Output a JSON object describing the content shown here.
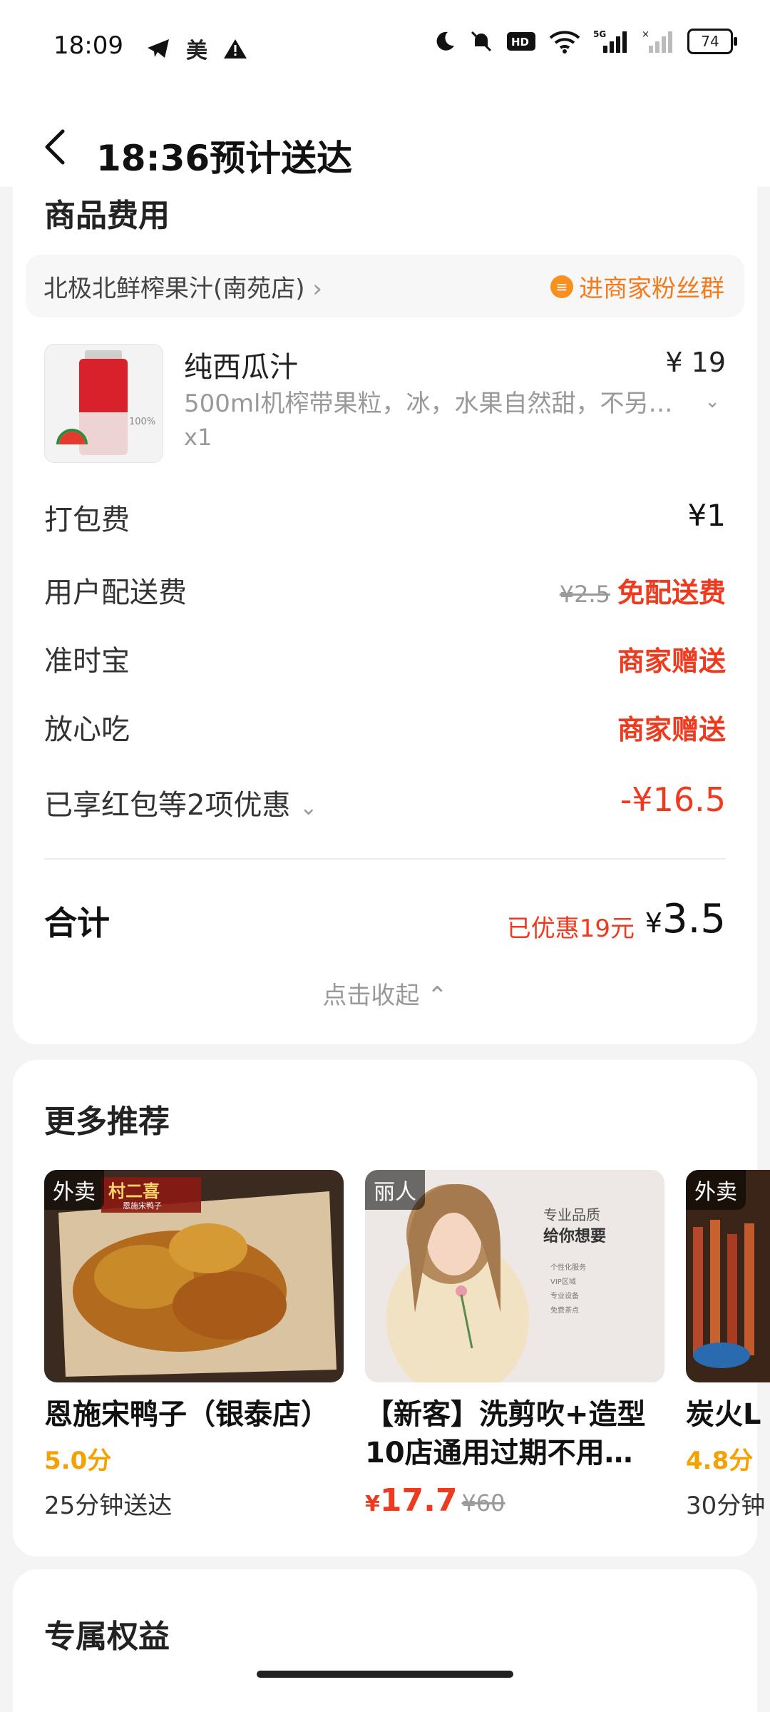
{
  "status_bar": {
    "time": "18:09",
    "carrier_tag": "美",
    "network": "5G",
    "battery": "74"
  },
  "header": {
    "title": "18:36预计送达"
  },
  "fees": {
    "section_title": "商品费用",
    "shop_name": "北极北鲜榨果汁(南苑店)",
    "fan_group": "进商家粉丝群",
    "product": {
      "name": "纯西瓜汁",
      "desc": "500ml机榨带果粒，冰，水果自然甜，不另…",
      "qty": "x1",
      "price": "¥ 19",
      "image_label": "100%"
    },
    "rows": [
      {
        "label": "打包费",
        "value": "¥1"
      },
      {
        "label": "用户配送费",
        "original": "¥2.5",
        "value": "免配送费"
      },
      {
        "label": "准时宝",
        "value": "商家赠送"
      },
      {
        "label": "放心吃",
        "value": "商家赠送"
      },
      {
        "label": "已享红包等2项优惠",
        "value": "-¥16.5"
      }
    ],
    "total_label": "合计",
    "saved": "已优惠19元",
    "total_yen": "¥",
    "total_amount": "3.5",
    "collapse": "点击收起"
  },
  "recommend": {
    "title": "更多推荐",
    "items": [
      {
        "tag": "外卖",
        "name": "恩施宋鸭子（银泰店）",
        "score": "5.0分",
        "eta": "25分钟送达",
        "banner": "村二喜",
        "banner_sub": "恩施宋鸭子"
      },
      {
        "tag": "丽人",
        "name": "【新客】洗剪吹+造型10店通用过期不用…",
        "price": "17.7",
        "orig": "¥60",
        "yen": "¥",
        "poster_title1": "专业品质",
        "poster_title2": "给你想要",
        "poster_list": [
          "个性化服务",
          "VIP区域",
          "专业设备",
          "免费茶点"
        ]
      },
      {
        "tag": "外卖",
        "name": "炭火L",
        "score": "4.8分",
        "eta": "30分钟"
      }
    ]
  },
  "benefits": {
    "title": "专属权益"
  },
  "colors": {
    "accent_red": "#ee3a1f",
    "accent_orange": "#f37b1d",
    "score_yellow": "#f5a100"
  }
}
